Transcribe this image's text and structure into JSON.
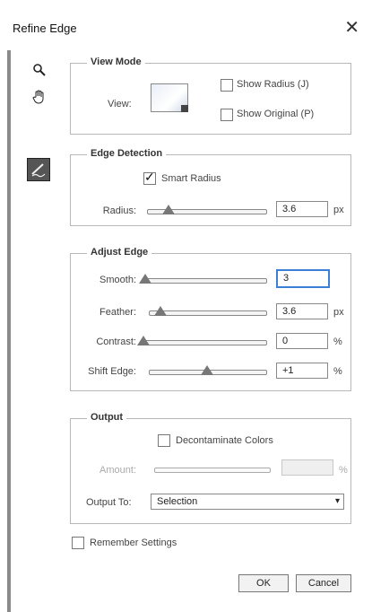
{
  "window": {
    "title": "Refine Edge"
  },
  "view_mode": {
    "legend": "View Mode",
    "view_label": "View:",
    "show_radius_label": "Show Radius (J)",
    "show_original_label": "Show Original (P)"
  },
  "edge_detection": {
    "legend": "Edge Detection",
    "smart_radius_label": "Smart Radius",
    "smart_radius_checked": true,
    "radius_label": "Radius:",
    "radius_value": "3.6",
    "radius_unit": "px",
    "radius_level": 0.18
  },
  "adjust_edge": {
    "legend": "Adjust Edge",
    "smooth_label": "Smooth:",
    "smooth_value": "3",
    "smooth_level": 0.03,
    "feather_label": "Feather:",
    "feather_value": "3.6",
    "feather_unit": "px",
    "feather_level": 0.1,
    "contrast_label": "Contrast:",
    "contrast_value": "0",
    "contrast_unit": "%",
    "contrast_level": 0.0,
    "shift_label": "Shift Edge:",
    "shift_value": "+1",
    "shift_unit": "%",
    "shift_level": 0.5
  },
  "output": {
    "legend": "Output",
    "decontaminate_label": "Decontaminate Colors",
    "amount_label": "Amount:",
    "amount_unit": "%",
    "output_to_label": "Output To:",
    "output_to_value": "Selection"
  },
  "remember_label": "Remember Settings",
  "buttons": {
    "ok": "OK",
    "cancel": "Cancel"
  },
  "icons": [
    "zoom-icon",
    "hand-icon",
    "refine-radius-tool-icon",
    "close-icon"
  ]
}
